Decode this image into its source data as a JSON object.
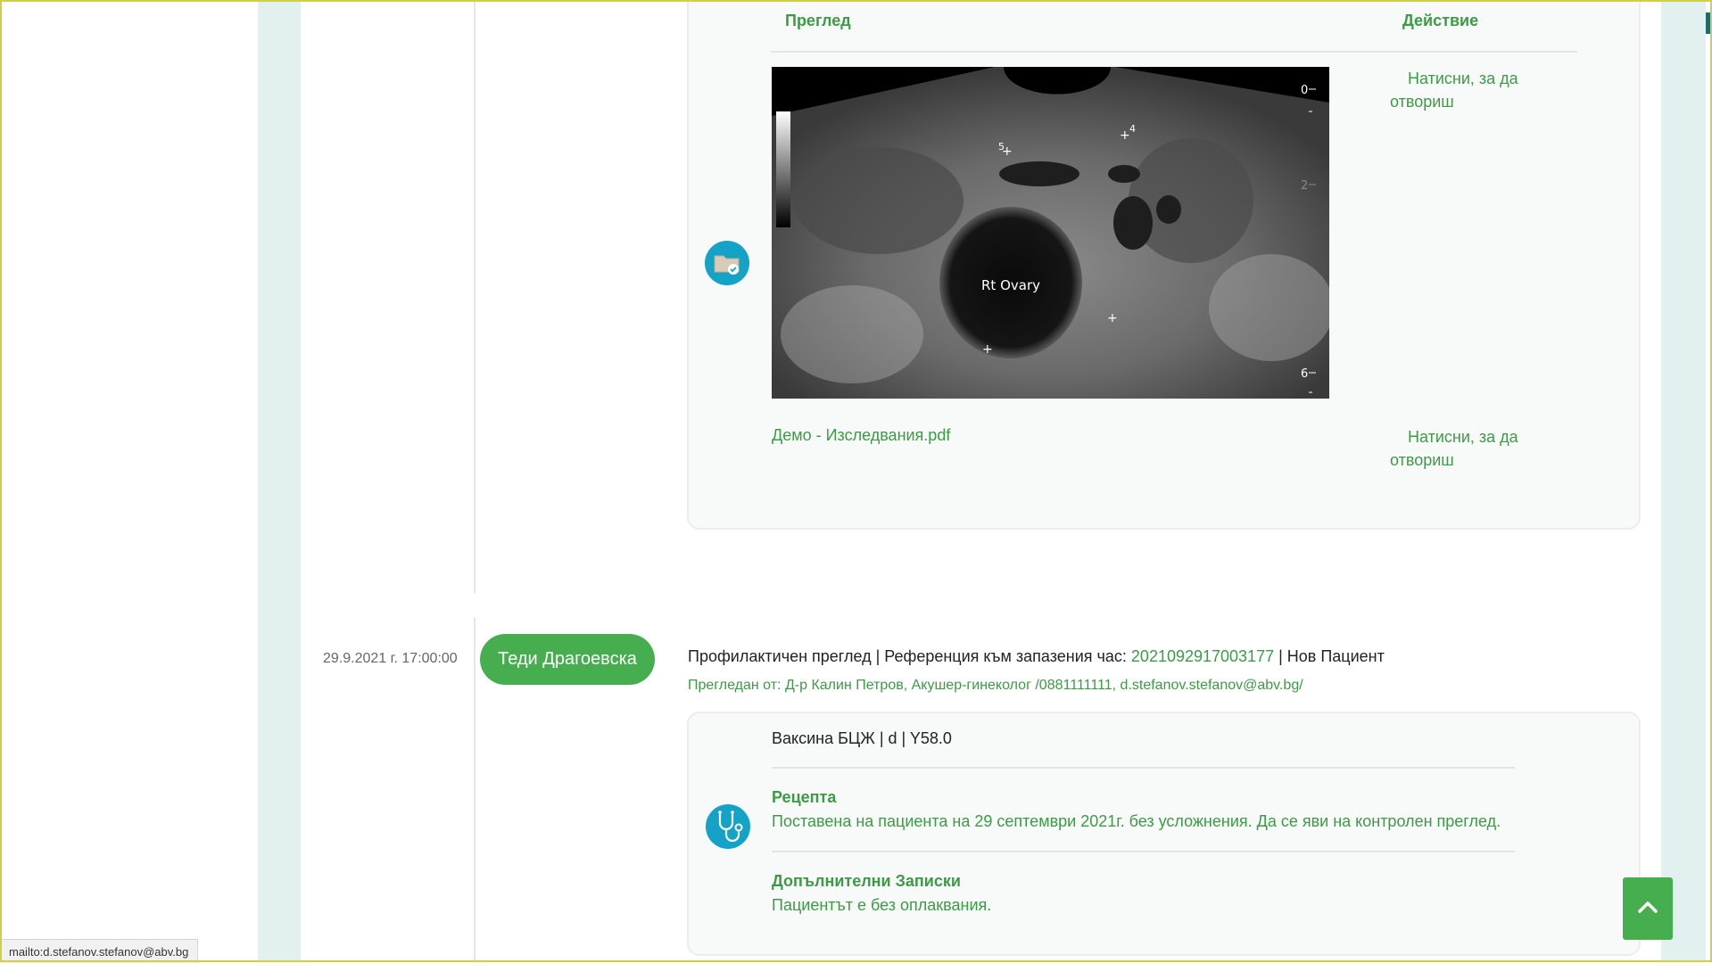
{
  "table_header": {
    "preview": "Преглед",
    "action": "Действие"
  },
  "attachments": [
    {
      "image_label": "Rt Ovary",
      "action_label": "Натисни, за да отвориш"
    },
    {
      "file_name": "Демо - Изследвания.pdf",
      "action_label": "Натисни, за да отвориш"
    }
  ],
  "ultrasound_marks": {
    "mark5": "5",
    "mark4": "4",
    "scale_0": "0",
    "scale_2": "2",
    "scale_6": "6"
  },
  "visit": {
    "date": "29.9.2021 г. 17:00:00",
    "patient_name": "Теди Драгоевска",
    "title_prefix": "Профилактичен преглед | Референция към запазения час: ",
    "reference": "2021092917003177",
    "title_suffix": " | Нов Пациент",
    "examined_by": "Прегледан от: Д-р Калин Петров, Акушер-гинеколог /0881111111, d.stefanov.stefanov@abv.bg/"
  },
  "record": {
    "vaccine": "Ваксина БЦЖ | d | Y58.0",
    "prescription_title": "Рецепта",
    "prescription_text": "Поставена на пациента на 29 септември 2021г. без усложнения. Да се яви на контролен преглед.",
    "notes_title": "Допълнителни Записки",
    "notes_text": "Пациентът е без оплаквания."
  },
  "icons": {
    "folder": "folder-check-icon",
    "stethoscope": "stethoscope-icon",
    "scroll_top": "chevron-up-icon"
  },
  "colors": {
    "accent_green": "#3d9a45",
    "pill_green": "#47ae4f",
    "icon_blue": "#14a3c7"
  },
  "status_bar": {
    "link": "mailto:d.stefanov.stefanov@abv.bg"
  }
}
